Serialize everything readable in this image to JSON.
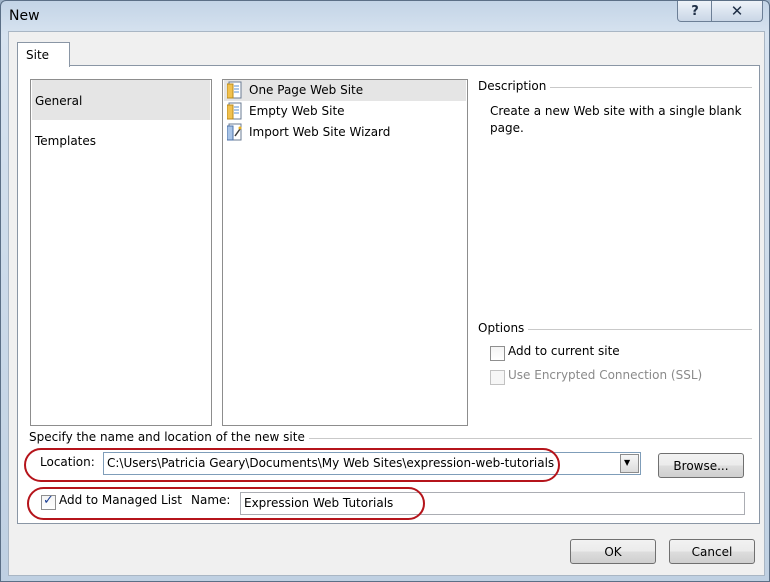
{
  "window": {
    "title": "New",
    "help_glyph": "?",
    "close_glyph": "✕"
  },
  "tabs": [
    {
      "label": "Site"
    }
  ],
  "categories": [
    {
      "label": "General",
      "selected": true
    },
    {
      "label": "Templates",
      "selected": false
    }
  ],
  "templates": [
    {
      "label": "One Page Web Site",
      "icon": "page-icon",
      "selected": true
    },
    {
      "label": "Empty Web Site",
      "icon": "page-icon",
      "selected": false
    },
    {
      "label": "Import Web Site Wizard",
      "icon": "wizard-icon",
      "selected": false
    }
  ],
  "description": {
    "heading": "Description",
    "text": "Create a new Web site with a single blank page."
  },
  "options": {
    "heading": "Options",
    "add_to_current_site": {
      "label": "Add to current site",
      "checked": false,
      "enabled": true
    },
    "use_ssl": {
      "label": "Use Encrypted Connection (SSL)",
      "checked": false,
      "enabled": false
    }
  },
  "location_section": {
    "heading": "Specify the name and location of the new site",
    "location_label": "Location:",
    "location_value": "C:\\Users\\Patricia Geary\\Documents\\My Web Sites\\expression-web-tutorials",
    "browse_label": "Browse...",
    "managed_list_label": "Add to Managed List",
    "managed_list_checked": true,
    "name_label": "Name:",
    "name_value": "Expression Web Tutorials"
  },
  "footer": {
    "ok_label": "OK",
    "cancel_label": "Cancel"
  },
  "colors": {
    "highlight_circle": "#b5141b",
    "selection_bg": "#e5e5e5"
  }
}
